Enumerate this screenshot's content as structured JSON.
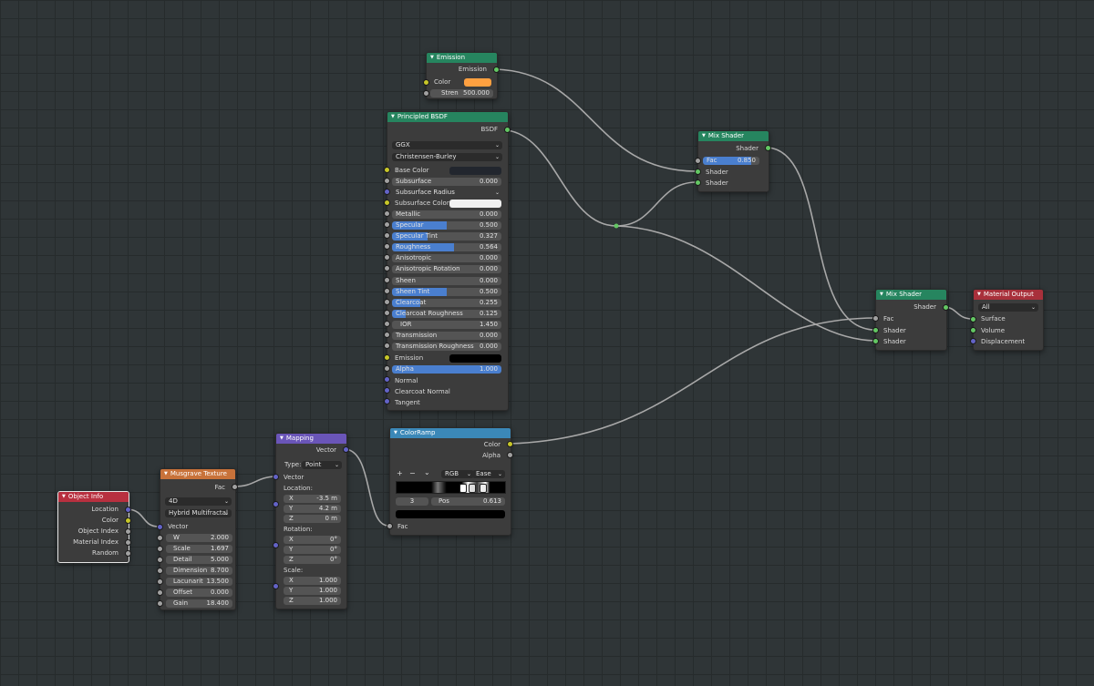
{
  "colors": {
    "header_output": "#26855f",
    "header_shader": "#2d8a5d",
    "header_texture": "#c8723a",
    "header_vector": "#6a55b8",
    "header_input": "#b8303f",
    "header_converter": "#3b88b8",
    "header_material_output": "#a8303b",
    "field_fill": "#4a7fcf",
    "emission_color": "#ffa040",
    "base_color": "#22262e",
    "subsurface_color": "#f0f0f0",
    "emission_black": "#000000"
  },
  "emission": {
    "title": "Emission",
    "out_label": "Emission",
    "color_label": "Color",
    "strength_label": "Stren",
    "strength_value": "500.000"
  },
  "principled": {
    "title": "Principled BSDF",
    "out_label": "BSDF",
    "distribution": "GGX",
    "subsurface_method": "Christensen-Burley",
    "base_color_label": "Base Color",
    "subsurface_radius_label": "Subsurface Radius",
    "subsurface_color_label": "Subsurface Color",
    "emission_label": "Emission",
    "params": [
      {
        "label": "Subsurface",
        "value": "0.000",
        "fill": 0
      },
      {
        "label": "Metallic",
        "value": "0.000",
        "fill": 0
      },
      {
        "label": "Specular",
        "value": "0.500",
        "fill": 0.5
      },
      {
        "label": "Specular Tint",
        "value": "0.327",
        "fill": 0.327
      },
      {
        "label": "Roughness",
        "value": "0.564",
        "fill": 0.564
      },
      {
        "label": "Anisotropic",
        "value": "0.000",
        "fill": 0
      },
      {
        "label": "Anisotropic Rotation",
        "value": "0.000",
        "fill": 0
      },
      {
        "label": "Sheen",
        "value": "0.000",
        "fill": 0
      },
      {
        "label": "Sheen Tint",
        "value": "0.500",
        "fill": 0.5
      },
      {
        "label": "Clearcoat",
        "value": "0.255",
        "fill": 0.255
      },
      {
        "label": "Clearcoat Roughness",
        "value": "0.125",
        "fill": 0.125
      },
      {
        "label": "IOR",
        "value": "1.450",
        "fill": 0
      },
      {
        "label": "Transmission",
        "value": "0.000",
        "fill": 0
      },
      {
        "label": "Transmission Roughness",
        "value": "0.000",
        "fill": 0
      },
      {
        "label": "Alpha",
        "value": "1.000",
        "fill": 1
      }
    ],
    "normal_label": "Normal",
    "clearcoat_normal_label": "Clearcoat Normal",
    "tangent_label": "Tangent"
  },
  "mix1": {
    "title": "Mix Shader",
    "out_label": "Shader",
    "fac_label": "Fac",
    "fac_value": "0.850",
    "fac_fill": 0.85,
    "in1_label": "Shader",
    "in2_label": "Shader"
  },
  "mix2": {
    "title": "Mix Shader",
    "out_label": "Shader",
    "fac_label": "Fac",
    "in1_label": "Shader",
    "in2_label": "Shader"
  },
  "matout": {
    "title": "Material Output",
    "target": "All",
    "surface_label": "Surface",
    "volume_label": "Volume",
    "displacement_label": "Displacement"
  },
  "colorramp": {
    "title": "ColorRamp",
    "color_label": "Color",
    "alpha_label": "Alpha",
    "plus": "+",
    "minus": "−",
    "chevron": "⌄",
    "mode": "RGB",
    "interpolation": "Ease",
    "index": "3",
    "pos_label": "Pos",
    "pos_value": "0.613",
    "fac_label": "Fac"
  },
  "mapping": {
    "title": "Mapping",
    "out_label": "Vector",
    "type_label": "Type:",
    "type_value": "Point",
    "vector_label": "Vector",
    "location_label": "Location:",
    "location": [
      {
        "axis": "X",
        "value": "-3.5 m"
      },
      {
        "axis": "Y",
        "value": "4.2 m"
      },
      {
        "axis": "Z",
        "value": "0 m"
      }
    ],
    "rotation_label": "Rotation:",
    "rotation": [
      {
        "axis": "X",
        "value": "0°"
      },
      {
        "axis": "Y",
        "value": "0°"
      },
      {
        "axis": "Z",
        "value": "0°"
      }
    ],
    "scale_label": "Scale:",
    "scale": [
      {
        "axis": "X",
        "value": "1.000"
      },
      {
        "axis": "Y",
        "value": "1.000"
      },
      {
        "axis": "Z",
        "value": "1.000"
      }
    ]
  },
  "musgrave": {
    "title": "Musgrave Texture",
    "out_label": "Fac",
    "dimensions": "4D",
    "type": "Hybrid Multifractal",
    "vector_label": "Vector",
    "params": [
      {
        "label": "W",
        "value": "2.000"
      },
      {
        "label": "Scale",
        "value": "1.697"
      },
      {
        "label": "Detail",
        "value": "5.000"
      },
      {
        "label": "Dimension",
        "value": "8.700"
      },
      {
        "label": "Lacunarit",
        "value": "13.500"
      },
      {
        "label": "Offset",
        "value": "0.000"
      },
      {
        "label": "Gain",
        "value": "18.400"
      }
    ]
  },
  "objinfo": {
    "title": "Object Info",
    "outputs": [
      "Location",
      "Color",
      "Object Index",
      "Material Index",
      "Random"
    ]
  }
}
